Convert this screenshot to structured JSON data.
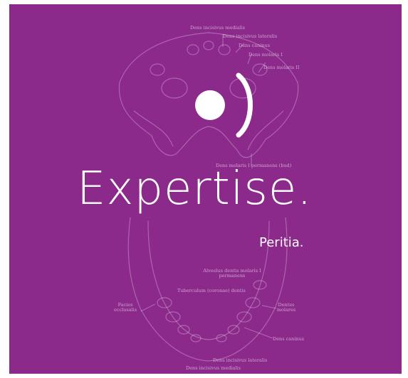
{
  "colors": {
    "background": "#8c2a8c",
    "foreground": "#ffffff"
  },
  "headline": "Expertise.",
  "subline": "Peritia.",
  "logo": {
    "icon": "dot-paren-logo-icon"
  },
  "anatomy_labels": {
    "upper": [
      "Dens incisivus medialis",
      "Dens incisivus lateralis",
      "Dens caninus",
      "Dens molaris I",
      "Dens molaris II",
      "Dens molaris I permanens (bud)"
    ],
    "lower": {
      "alveolus": "Alveolus dentis molaris I permanens",
      "tuberculum": "Tuberculum (coronae) dentis",
      "facies_left": "Facies occlusalis",
      "dentes_molares": "Dentes molares",
      "dens_caninus": "Dens caninus",
      "incisivus_lateralis": "Dens incisivus lateralis",
      "incisivus_medialis": "Dens incisivus medialis"
    }
  }
}
